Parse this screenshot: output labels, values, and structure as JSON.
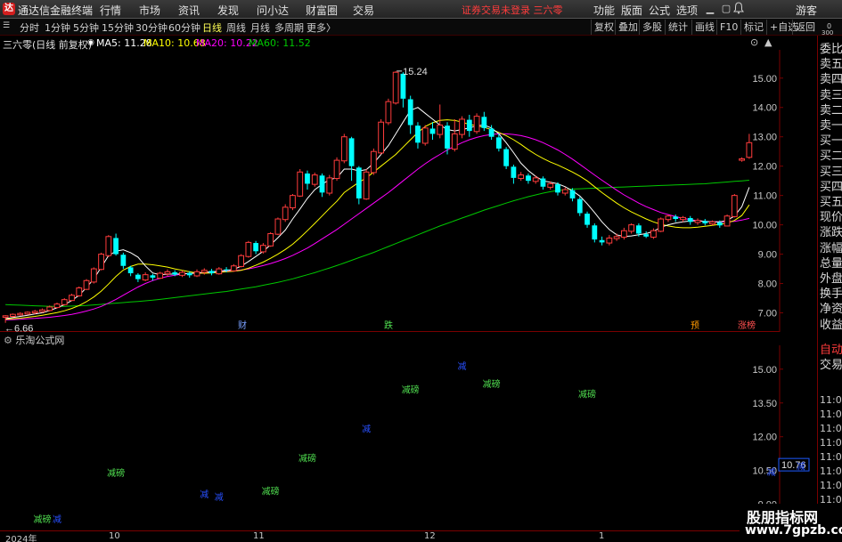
{
  "menubar": {
    "app_title": "通达信金融终端",
    "logo_glyph": "达",
    "items": [
      "行情",
      "市场",
      "资讯",
      "发现",
      "问小达",
      "财富圈",
      "交易"
    ],
    "status": "证券交易未登录  三六零",
    "right_items": [
      "功能",
      "版面",
      "公式",
      "选项"
    ],
    "guest": "游客"
  },
  "periodbar": {
    "periods": [
      "分时",
      "1分钟",
      "5分钟",
      "15分钟",
      "30分钟",
      "60分钟",
      "日线",
      "周线",
      "月线",
      "多周期",
      "更多〉"
    ],
    "active": "日线",
    "tools": [
      "复权",
      "叠加",
      "多股",
      "统计",
      "画线",
      "F10",
      "标记",
      "+自选",
      "返回"
    ]
  },
  "infoline": {
    "stock": "三六零(日线 前复权)",
    "ma5": "MA5: 11.28",
    "ma10": "MA10: 10.68",
    "ma20": "MA20: 10.22",
    "ma60": "MA60: 11.52"
  },
  "colors": {
    "up": "#ff3c3c",
    "down": "#00ffff",
    "ma5": "#ffffff",
    "ma10": "#ffff00",
    "ma20": "#ff00ff",
    "ma60": "#00c800",
    "axis_red": "#7a0000"
  },
  "main_axis_labels": [
    "15.00",
    "14.00",
    "13.00",
    "12.00",
    "11.00",
    "10.00",
    "9.00",
    "8.00",
    "7.00"
  ],
  "main_annotations": {
    "high": "15.24",
    "low": "6.66"
  },
  "event_marks": [
    {
      "label": "财",
      "kind": "cai"
    },
    {
      "label": "跌",
      "kind": "die"
    },
    {
      "label": "预",
      "kind": "yu"
    },
    {
      "label": "涨榜",
      "kind": "zt"
    }
  ],
  "indicator": {
    "title": "乐淘公式网",
    "axis_labels": [
      "15.00",
      "13.50",
      "12.00",
      "10.50",
      "9.00"
    ],
    "current_value": "10.76",
    "signal_green": "减磅",
    "signal_blue": "减"
  },
  "rpanel": {
    "ratio_top": "0",
    "ratio_bot": "300",
    "labels": [
      "委比",
      "卖五",
      "卖四",
      "卖三",
      "卖二",
      "卖一",
      "买一",
      "买二",
      "买三",
      "买四",
      "买五",
      "现价",
      "涨跌",
      "涨幅",
      "总量",
      "外盘",
      "换手",
      "净资",
      "收益"
    ],
    "tabs": [
      "自动",
      "交易"
    ],
    "times": [
      "11:09",
      "11:09",
      "11:09",
      "11:09",
      "11:09",
      "11:09",
      "11:09",
      "11:09",
      "11:09",
      "11:09",
      "11:09"
    ]
  },
  "date_axis": [
    "2024年",
    "10",
    "11",
    "12",
    "1"
  ],
  "watermark": {
    "line1": "股朋指标网",
    "line2": "www.7gpzb.com"
  },
  "chart_data": {
    "type": "candlestick",
    "title": "三六零(日线 前复权)",
    "ylim": [
      6.5,
      15.6
    ],
    "series_names": [
      "MA5",
      "MA10",
      "MA20",
      "MA60"
    ],
    "candles": [
      [
        6.85,
        6.9,
        6.66,
        6.92
      ],
      [
        6.88,
        6.95,
        6.85,
        6.98
      ],
      [
        6.93,
        6.98,
        6.9,
        7.02
      ],
      [
        6.96,
        7.02,
        6.94,
        7.05
      ],
      [
        7.0,
        7.05,
        6.95,
        7.1
      ],
      [
        7.04,
        7.1,
        7.0,
        7.15
      ],
      [
        7.08,
        7.2,
        7.05,
        7.25
      ],
      [
        7.18,
        7.3,
        7.15,
        7.35
      ],
      [
        7.28,
        7.45,
        7.25,
        7.5
      ],
      [
        7.42,
        7.6,
        7.4,
        7.65
      ],
      [
        7.58,
        7.85,
        7.55,
        7.9
      ],
      [
        7.8,
        8.1,
        7.78,
        8.15
      ],
      [
        8.05,
        8.5,
        8.0,
        8.55
      ],
      [
        8.48,
        9.0,
        8.45,
        9.05
      ],
      [
        8.95,
        9.6,
        8.9,
        9.65
      ],
      [
        9.55,
        9.0,
        8.95,
        9.7
      ],
      [
        8.98,
        8.6,
        8.5,
        9.05
      ],
      [
        8.55,
        8.35,
        8.25,
        8.6
      ],
      [
        8.3,
        8.15,
        8.05,
        8.35
      ],
      [
        8.12,
        8.3,
        8.08,
        8.38
      ],
      [
        8.28,
        8.2,
        8.1,
        8.33
      ],
      [
        8.18,
        8.35,
        8.15,
        8.4
      ],
      [
        8.33,
        8.4,
        8.25,
        8.48
      ],
      [
        8.38,
        8.3,
        8.25,
        8.45
      ],
      [
        8.28,
        8.38,
        8.22,
        8.45
      ],
      [
        8.36,
        8.28,
        8.2,
        8.42
      ],
      [
        8.26,
        8.4,
        8.22,
        8.48
      ],
      [
        8.38,
        8.45,
        8.3,
        8.52
      ],
      [
        8.43,
        8.35,
        8.28,
        8.5
      ],
      [
        8.33,
        8.5,
        8.3,
        8.56
      ],
      [
        8.48,
        8.45,
        8.38,
        8.56
      ],
      [
        8.43,
        8.6,
        8.4,
        8.66
      ],
      [
        8.58,
        8.95,
        8.55,
        9.0
      ],
      [
        8.92,
        9.4,
        8.88,
        9.45
      ],
      [
        9.38,
        9.1,
        9.0,
        9.45
      ],
      [
        9.08,
        9.3,
        9.02,
        9.38
      ],
      [
        9.28,
        9.7,
        9.25,
        9.75
      ],
      [
        9.68,
        10.2,
        9.65,
        10.25
      ],
      [
        10.18,
        10.6,
        10.1,
        10.7
      ],
      [
        10.58,
        11.0,
        10.5,
        11.05
      ],
      [
        10.98,
        11.8,
        10.95,
        11.9
      ],
      [
        11.75,
        11.4,
        11.2,
        11.85
      ],
      [
        11.38,
        11.7,
        11.3,
        11.78
      ],
      [
        11.68,
        11.1,
        10.95,
        11.75
      ],
      [
        11.08,
        11.6,
        11.0,
        11.7
      ],
      [
        11.58,
        12.2,
        11.5,
        12.3
      ],
      [
        12.18,
        13.0,
        12.1,
        13.1
      ],
      [
        12.95,
        12.0,
        11.5,
        13.0
      ],
      [
        11.95,
        10.9,
        10.7,
        12.0
      ],
      [
        10.88,
        11.8,
        10.85,
        11.9
      ],
      [
        11.78,
        12.5,
        11.7,
        12.6
      ],
      [
        12.45,
        13.5,
        12.4,
        13.6
      ],
      [
        13.48,
        14.2,
        13.4,
        14.3
      ],
      [
        14.15,
        15.2,
        14.1,
        15.24
      ],
      [
        15.15,
        14.3,
        14.0,
        15.2
      ],
      [
        14.28,
        13.4,
        13.1,
        14.4
      ],
      [
        13.38,
        12.8,
        12.6,
        13.5
      ],
      [
        12.78,
        13.3,
        12.7,
        13.4
      ],
      [
        13.28,
        13.1,
        12.9,
        13.5
      ],
      [
        13.08,
        13.4,
        12.95,
        14.1
      ],
      [
        13.38,
        12.6,
        12.4,
        13.5
      ],
      [
        12.58,
        13.1,
        12.5,
        13.6
      ],
      [
        13.08,
        13.6,
        12.95,
        13.7
      ],
      [
        13.58,
        13.2,
        13.0,
        13.75
      ],
      [
        13.18,
        13.7,
        13.1,
        13.8
      ],
      [
        13.68,
        13.3,
        13.2,
        13.85
      ],
      [
        13.28,
        13.0,
        12.9,
        13.4
      ],
      [
        12.98,
        12.6,
        12.5,
        13.1
      ],
      [
        12.58,
        12.0,
        11.9,
        12.65
      ],
      [
        11.98,
        11.6,
        11.4,
        12.05
      ],
      [
        11.58,
        11.7,
        11.5,
        11.8
      ],
      [
        11.68,
        11.5,
        11.4,
        11.75
      ],
      [
        11.48,
        11.6,
        11.4,
        11.68
      ],
      [
        11.58,
        11.3,
        11.2,
        11.65
      ],
      [
        11.28,
        11.4,
        11.2,
        11.48
      ],
      [
        11.38,
        11.1,
        11.0,
        11.45
      ],
      [
        11.08,
        11.2,
        11.0,
        11.28
      ],
      [
        11.18,
        10.9,
        10.8,
        11.25
      ],
      [
        10.88,
        10.4,
        10.3,
        10.95
      ],
      [
        10.38,
        10.0,
        9.9,
        10.45
      ],
      [
        9.98,
        9.5,
        9.4,
        10.05
      ],
      [
        9.48,
        9.4,
        9.3,
        9.6
      ],
      [
        9.38,
        9.55,
        9.3,
        9.65
      ],
      [
        9.53,
        9.6,
        9.45,
        9.7
      ],
      [
        9.58,
        9.8,
        9.5,
        9.9
      ],
      [
        9.78,
        10.0,
        9.7,
        10.05
      ],
      [
        9.98,
        9.7,
        9.6,
        10.05
      ],
      [
        9.68,
        9.6,
        9.55,
        9.78
      ],
      [
        9.58,
        9.8,
        9.52,
        9.88
      ],
      [
        9.78,
        10.2,
        9.75,
        10.25
      ],
      [
        10.18,
        10.3,
        10.1,
        10.35
      ],
      [
        10.28,
        10.2,
        10.1,
        10.35
      ],
      [
        10.18,
        10.25,
        10.1,
        10.3
      ],
      [
        10.23,
        10.1,
        10.0,
        10.3
      ],
      [
        10.08,
        10.15,
        10.0,
        10.22
      ],
      [
        10.13,
        10.05,
        9.98,
        10.2
      ],
      [
        10.03,
        10.1,
        9.98,
        10.15
      ],
      [
        10.08,
        9.98,
        9.9,
        10.15
      ],
      [
        9.96,
        10.3,
        9.95,
        10.35
      ],
      [
        10.28,
        11.0,
        10.25,
        11.05
      ],
      [
        12.2,
        12.25,
        12.15,
        12.3
      ],
      [
        12.3,
        12.8,
        12.25,
        13.1
      ]
    ],
    "ma5": [
      6.8,
      6.84,
      6.88,
      6.92,
      6.96,
      7.0,
      7.08,
      7.17,
      7.28,
      7.42,
      7.6,
      7.86,
      8.16,
      8.55,
      8.95,
      9.1,
      9.15,
      9.05,
      8.9,
      8.6,
      8.36,
      8.3,
      8.32,
      8.32,
      8.33,
      8.34,
      8.36,
      8.38,
      8.4,
      8.42,
      8.45,
      8.48,
      8.59,
      8.75,
      8.92,
      9.1,
      9.32,
      9.56,
      9.82,
      10.2,
      10.54,
      10.9,
      11.2,
      11.38,
      11.54,
      11.6,
      11.9,
      11.9,
      11.84,
      11.88,
      12.1,
      12.4,
      12.7,
      13.1,
      13.5,
      13.9,
      14.0,
      13.8,
      13.6,
      13.4,
      13.25,
      13.2,
      13.25,
      13.3,
      13.38,
      13.4,
      13.3,
      13.1,
      12.8,
      12.46,
      12.1,
      11.85,
      11.65,
      11.5,
      11.45,
      11.4,
      11.3,
      11.16,
      10.98,
      10.72,
      10.42,
      10.1,
      9.84,
      9.66,
      9.6,
      9.62,
      9.66,
      9.7,
      9.78,
      9.92,
      10.0,
      10.06,
      10.1,
      10.13,
      10.14,
      10.12,
      10.1,
      10.1,
      10.15,
      10.3,
      10.62,
      11.28
    ],
    "ma10": [
      6.78,
      6.8,
      6.82,
      6.85,
      6.88,
      6.92,
      6.96,
      7.01,
      7.07,
      7.15,
      7.25,
      7.38,
      7.54,
      7.74,
      7.98,
      8.24,
      8.46,
      8.58,
      8.66,
      8.66,
      8.64,
      8.6,
      8.56,
      8.5,
      8.45,
      8.4,
      8.36,
      8.35,
      8.36,
      8.38,
      8.4,
      8.42,
      8.45,
      8.52,
      8.62,
      8.73,
      8.86,
      9.0,
      9.16,
      9.34,
      9.56,
      9.8,
      10.05,
      10.3,
      10.56,
      10.8,
      11.1,
      11.28,
      11.45,
      11.6,
      11.8,
      12.0,
      12.2,
      12.4,
      12.65,
      12.9,
      13.15,
      13.35,
      13.48,
      13.56,
      13.58,
      13.56,
      13.5,
      13.42,
      13.38,
      13.32,
      13.25,
      13.15,
      13.04,
      12.9,
      12.74,
      12.56,
      12.4,
      12.26,
      12.14,
      12.04,
      11.92,
      11.8,
      11.66,
      11.5,
      11.3,
      11.1,
      10.92,
      10.74,
      10.58,
      10.44,
      10.32,
      10.2,
      10.1,
      10.02,
      9.96,
      9.92,
      9.9,
      9.9,
      9.92,
      9.95,
      9.98,
      10.02,
      10.06,
      10.15,
      10.32,
      10.68
    ],
    "ma20": [
      6.76,
      6.77,
      6.78,
      6.8,
      6.81,
      6.83,
      6.85,
      6.88,
      6.91,
      6.95,
      7.0,
      7.06,
      7.13,
      7.22,
      7.33,
      7.46,
      7.6,
      7.74,
      7.88,
      8.0,
      8.1,
      8.18,
      8.24,
      8.28,
      8.32,
      8.34,
      8.35,
      8.36,
      8.38,
      8.4,
      8.42,
      8.44,
      8.46,
      8.5,
      8.55,
      8.61,
      8.68,
      8.76,
      8.85,
      8.96,
      9.08,
      9.21,
      9.36,
      9.52,
      9.68,
      9.84,
      10.02,
      10.2,
      10.38,
      10.56,
      10.74,
      10.92,
      11.1,
      11.3,
      11.5,
      11.7,
      11.9,
      12.08,
      12.25,
      12.4,
      12.55,
      12.68,
      12.8,
      12.9,
      12.98,
      13.04,
      13.08,
      13.1,
      13.1,
      13.08,
      13.04,
      12.98,
      12.9,
      12.8,
      12.68,
      12.55,
      12.4,
      12.24,
      12.06,
      11.88,
      11.7,
      11.52,
      11.35,
      11.18,
      11.02,
      10.88,
      10.74,
      10.62,
      10.52,
      10.42,
      10.35,
      10.28,
      10.22,
      10.18,
      10.14,
      10.12,
      10.1,
      10.1,
      10.11,
      10.12,
      10.16,
      10.22
    ],
    "ma60": [
      7.28,
      7.27,
      7.26,
      7.25,
      7.24,
      7.23,
      7.22,
      7.22,
      7.22,
      7.23,
      7.24,
      7.25,
      7.27,
      7.29,
      7.31,
      7.33,
      7.35,
      7.37,
      7.39,
      7.41,
      7.43,
      7.46,
      7.49,
      7.52,
      7.55,
      7.58,
      7.61,
      7.64,
      7.67,
      7.7,
      7.73,
      7.77,
      7.81,
      7.85,
      7.89,
      7.94,
      7.99,
      8.04,
      8.1,
      8.16,
      8.23,
      8.3,
      8.37,
      8.45,
      8.53,
      8.61,
      8.7,
      8.79,
      8.88,
      8.97,
      9.06,
      9.16,
      9.26,
      9.36,
      9.46,
      9.56,
      9.66,
      9.76,
      9.86,
      9.96,
      10.05,
      10.14,
      10.23,
      10.32,
      10.41,
      10.5,
      10.58,
      10.66,
      10.74,
      10.82,
      10.89,
      10.96,
      11.02,
      11.08,
      11.13,
      11.17,
      11.2,
      11.22,
      11.23,
      11.24,
      11.25,
      11.26,
      11.27,
      11.28,
      11.29,
      11.3,
      11.31,
      11.32,
      11.33,
      11.34,
      11.35,
      11.36,
      11.37,
      11.38,
      11.39,
      11.4,
      11.42,
      11.44,
      11.46,
      11.48,
      11.5,
      11.52
    ],
    "indicator_signals": [
      {
        "i": 5,
        "v": 8.2,
        "kind": "green"
      },
      {
        "i": 7,
        "v": 8.2,
        "kind": "blue"
      },
      {
        "i": 15,
        "v": 10.25,
        "kind": "green"
      },
      {
        "i": 27,
        "v": 9.3,
        "kind": "blue"
      },
      {
        "i": 29,
        "v": 9.18,
        "kind": "blue"
      },
      {
        "i": 36,
        "v": 9.45,
        "kind": "green"
      },
      {
        "i": 41,
        "v": 10.9,
        "kind": "green"
      },
      {
        "i": 49,
        "v": 12.2,
        "kind": "blue"
      },
      {
        "i": 55,
        "v": 13.95,
        "kind": "green"
      },
      {
        "i": 62,
        "v": 15.0,
        "kind": "blue"
      },
      {
        "i": 66,
        "v": 14.2,
        "kind": "green"
      },
      {
        "i": 79,
        "v": 13.75,
        "kind": "green"
      },
      {
        "i": 104,
        "v": 10.3,
        "kind": "blue"
      },
      {
        "i": 108,
        "v": 10.55,
        "kind": "blue"
      },
      {
        "i": 112,
        "v": 10.4,
        "kind": "green"
      }
    ]
  }
}
